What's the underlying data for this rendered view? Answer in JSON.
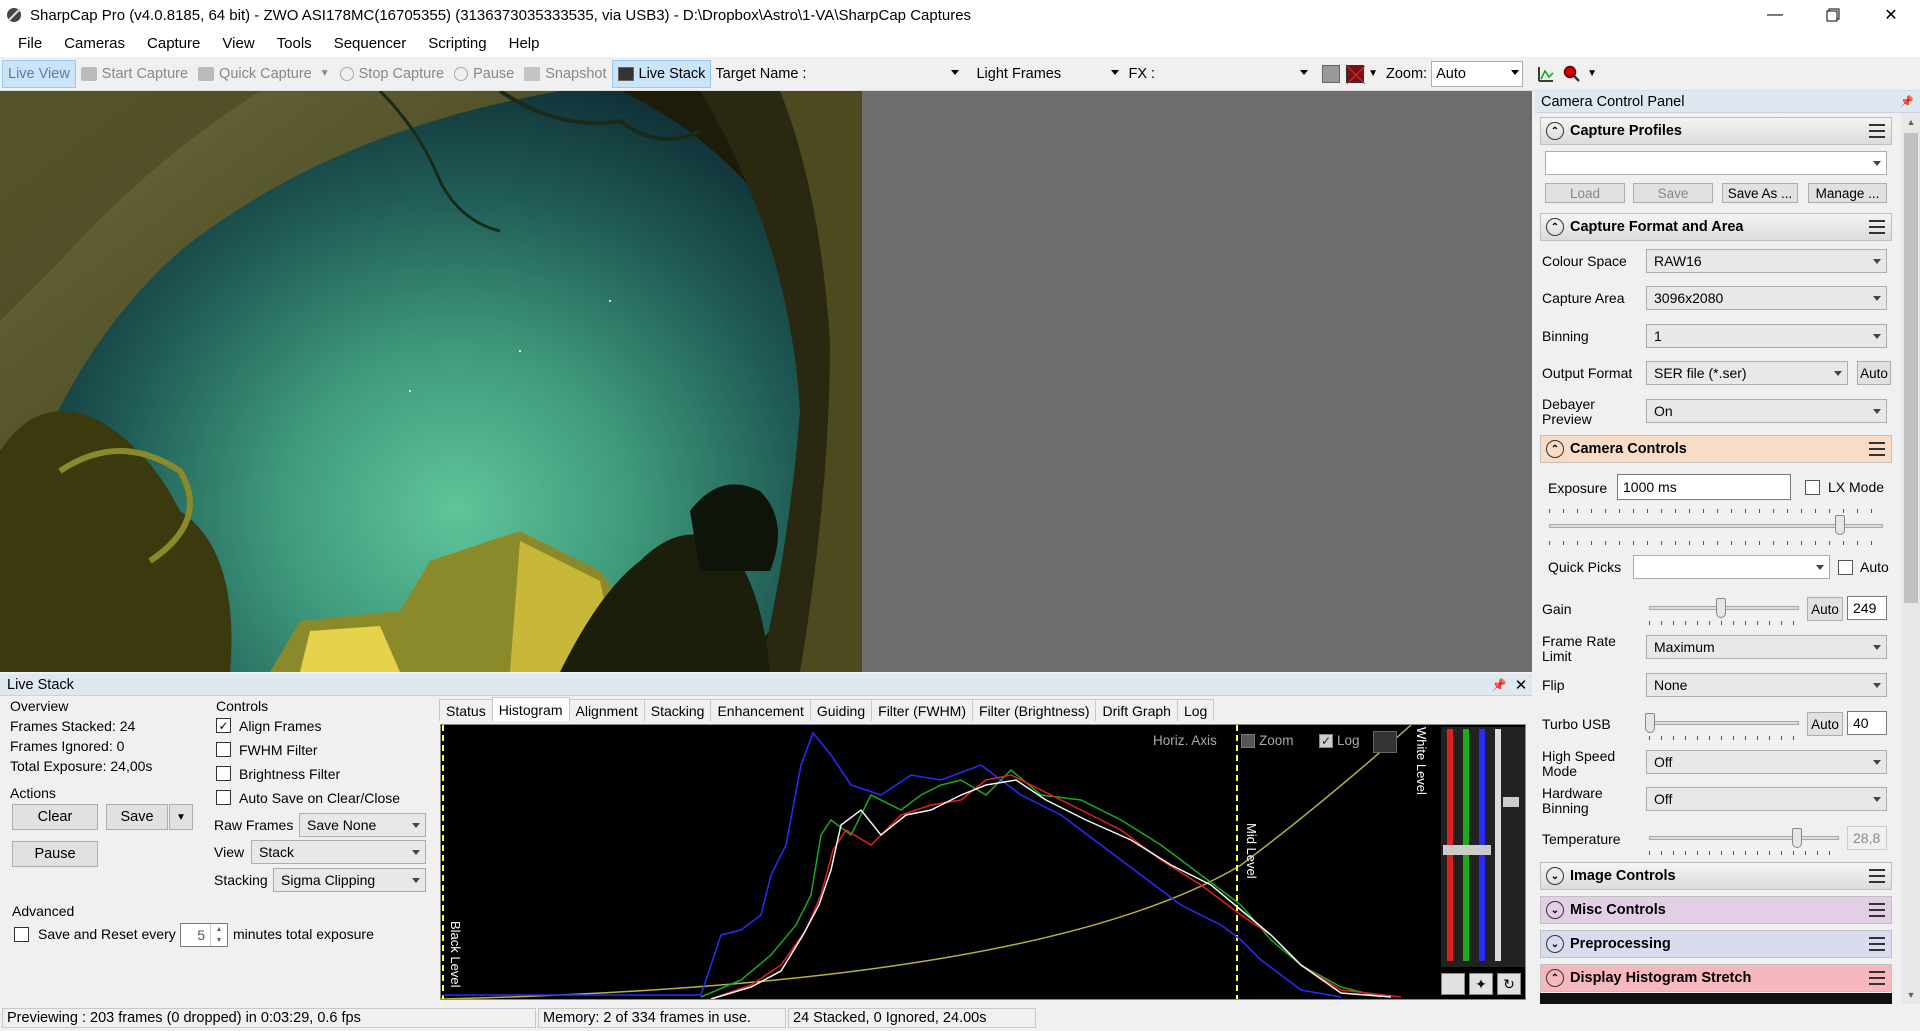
{
  "window": {
    "title": "SharpCap Pro (v4.0.8185, 64 bit) - ZWO ASI178MC(16705355) (3136373035333535, via USB3) - D:\\Dropbox\\Astro\\1-VA\\SharpCap Captures"
  },
  "menu": [
    "File",
    "Cameras",
    "Capture",
    "View",
    "Tools",
    "Sequencer",
    "Scripting",
    "Help"
  ],
  "toolbar": {
    "live_view": "Live View",
    "start_capture": "Start Capture",
    "quick_capture": "Quick Capture",
    "stop_capture": "Stop Capture",
    "pause": "Pause",
    "snapshot": "Snapshot",
    "live_stack": "Live Stack",
    "target_name_label": "Target Name :",
    "target_name_value": "",
    "frame_type": "Light Frames",
    "fx_label": "FX :",
    "fx_value": "",
    "zoom_label": "Zoom:",
    "zoom_value": "Auto"
  },
  "live_stack": {
    "panel_title": "Live Stack",
    "overview": {
      "heading": "Overview",
      "frames_stacked": "Frames Stacked: 24",
      "frames_ignored": "Frames Ignored:  0",
      "total_exposure": "Total Exposure:  24,00s"
    },
    "actions": {
      "heading": "Actions",
      "clear": "Clear",
      "save": "Save",
      "pause": "Pause"
    },
    "advanced": {
      "heading": "Advanced",
      "save_reset_label": "Save and Reset every",
      "save_reset_value": "5",
      "save_reset_suffix": "minutes total exposure",
      "save_reset_checked": false
    },
    "controls": {
      "heading": "Controls",
      "align_frames": "Align Frames",
      "align_frames_checked": true,
      "fwhm_filter": "FWHM Filter",
      "fwhm_filter_checked": false,
      "brightness_filter": "Brightness Filter",
      "brightness_filter_checked": false,
      "auto_save": "Auto Save on Clear/Close",
      "auto_save_checked": false,
      "raw_frames_label": "Raw Frames",
      "raw_frames_value": "Save None",
      "view_label": "View",
      "view_value": "Stack",
      "stacking_label": "Stacking",
      "stacking_value": "Sigma Clipping"
    },
    "tabs": [
      "Status",
      "Histogram",
      "Alignment",
      "Stacking",
      "Enhancement",
      "Guiding",
      "Filter (FWHM)",
      "Filter (Brightness)",
      "Drift Graph",
      "Log"
    ],
    "active_tab": "Histogram",
    "histogram": {
      "horiz_axis": "Horiz. Axis",
      "zoom": "Zoom",
      "zoom_checked": false,
      "log": "Log",
      "log_checked": true,
      "black_level": "Black Level",
      "mid_level": "Mid Level",
      "white_level": "White Level"
    }
  },
  "status_bar": {
    "previewing": "Previewing : 203 frames (0 dropped) in 0:03:29, 0.6 fps",
    "memory": "Memory: 2 of 334 frames in use.",
    "stack_info": "24 Stacked, 0 Ignored, 24.00s"
  },
  "camera_panel": {
    "title": "Camera Control Panel",
    "capture_profiles": {
      "heading": "Capture Profiles",
      "profile_value": "",
      "load": "Load",
      "save": "Save",
      "save_as": "Save As ...",
      "manage": "Manage ..."
    },
    "capture_format": {
      "heading": "Capture Format and Area",
      "colour_space_label": "Colour Space",
      "colour_space_value": "RAW16",
      "capture_area_label": "Capture Area",
      "capture_area_value": "3096x2080",
      "binning_label": "Binning",
      "binning_value": "1",
      "output_format_label": "Output Format",
      "output_format_value": "SER file (*.ser)",
      "output_auto": "Auto",
      "debayer_label_1": "Debayer",
      "debayer_label_2": "Preview",
      "debayer_value": "On"
    },
    "camera_controls": {
      "heading": "Camera Controls",
      "exposure_label": "Exposure",
      "exposure_value": "1000 ms",
      "lx_mode": "LX Mode",
      "lx_mode_checked": false,
      "quick_picks_label": "Quick Picks",
      "quick_picks_value": "",
      "quick_auto": "Auto",
      "gain_label": "Gain",
      "gain_auto": "Auto",
      "gain_value": "249",
      "frame_rate_label_1": "Frame Rate",
      "frame_rate_label_2": "Limit",
      "frame_rate_value": "Maximum",
      "flip_label": "Flip",
      "flip_value": "None",
      "turbo_label": "Turbo USB",
      "turbo_auto": "Auto",
      "turbo_value": "40",
      "high_speed_label_1": "High Speed",
      "high_speed_label_2": "Mode",
      "high_speed_value": "Off",
      "hw_binning_label_1": "Hardware",
      "hw_binning_label_2": "Binning",
      "hw_binning_value": "Off",
      "temperature_label": "Temperature",
      "temperature_value": "28,8"
    },
    "image_controls": "Image Controls",
    "misc_controls": "Misc Controls",
    "preprocessing": "Preprocessing",
    "display_histogram": "Display Histogram Stretch",
    "colors": {
      "camera_controls_bg": "#f8dcc6",
      "misc_controls_bg": "#e2cfe6",
      "preprocessing_bg": "#d8dcef",
      "display_histogram_bg": "#f6b8be"
    }
  }
}
